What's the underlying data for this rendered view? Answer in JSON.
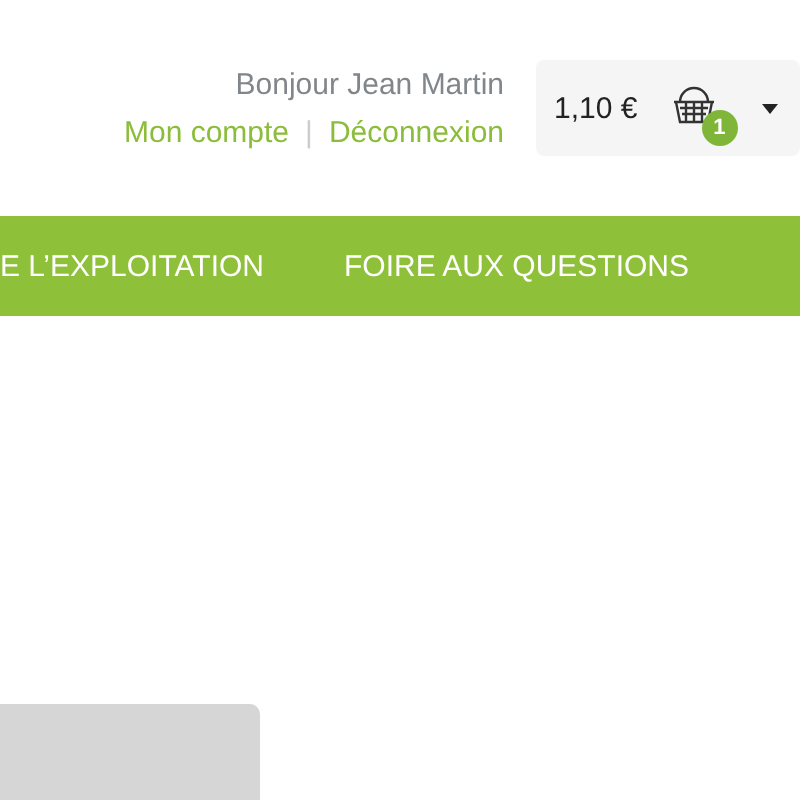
{
  "header": {
    "greeting": "Bonjour Jean Martin",
    "links": [
      "Mon compte",
      "Déconnexion"
    ],
    "separator": "|"
  },
  "cart": {
    "total": "1,10 €",
    "count": "1"
  },
  "nav": {
    "items": [
      {
        "label": "E L’EXPLOITATION"
      },
      {
        "label": "FOIRE AUX QUESTIONS"
      }
    ]
  }
}
